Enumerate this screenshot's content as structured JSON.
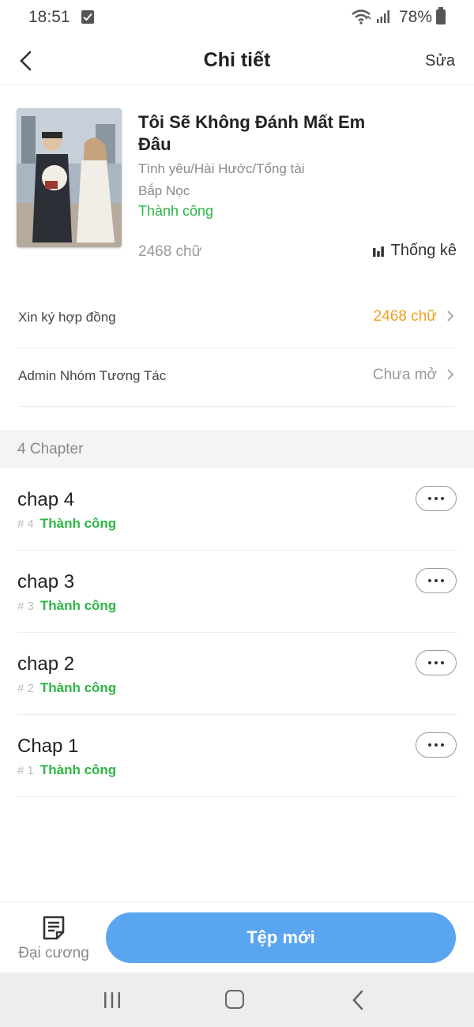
{
  "status_bar": {
    "time": "18:51",
    "battery": "78%"
  },
  "header": {
    "title": "Chi tiết",
    "edit_label": "Sửa"
  },
  "book": {
    "title": "Tôi Sẽ Không Đánh Mất Em Đâu",
    "genres": "Tình yêu/Hài Hước/Tổng tài",
    "author": "Bắp Nọc",
    "status": "Thành công",
    "word_count": "2468 chữ",
    "stats_label": "Thống kê"
  },
  "settings": {
    "contract": {
      "label": "Xin ký hợp đồng",
      "value": "2468 chữ",
      "color": "#f0a020"
    },
    "admin_group": {
      "label": "Admin Nhóm Tương Tác",
      "value": "Chưa mở",
      "color": "#999999"
    }
  },
  "chapters_section": {
    "label": "4 Chapter"
  },
  "chapters": [
    {
      "title": "chap 4",
      "number": "# 4",
      "status": "Thành công"
    },
    {
      "title": "chap 3",
      "number": "# 3",
      "status": "Thành công"
    },
    {
      "title": "chap 2",
      "number": "# 2",
      "status": "Thành công"
    },
    {
      "title": "Chap 1",
      "number": "# 1",
      "status": "Thành công"
    }
  ],
  "bottom_bar": {
    "outline_label": "Đại cương",
    "new_file_label": "Tệp mới"
  },
  "colors": {
    "accent_blue": "#5aa5f0",
    "success_green": "#2db544",
    "orange": "#f0a020"
  }
}
